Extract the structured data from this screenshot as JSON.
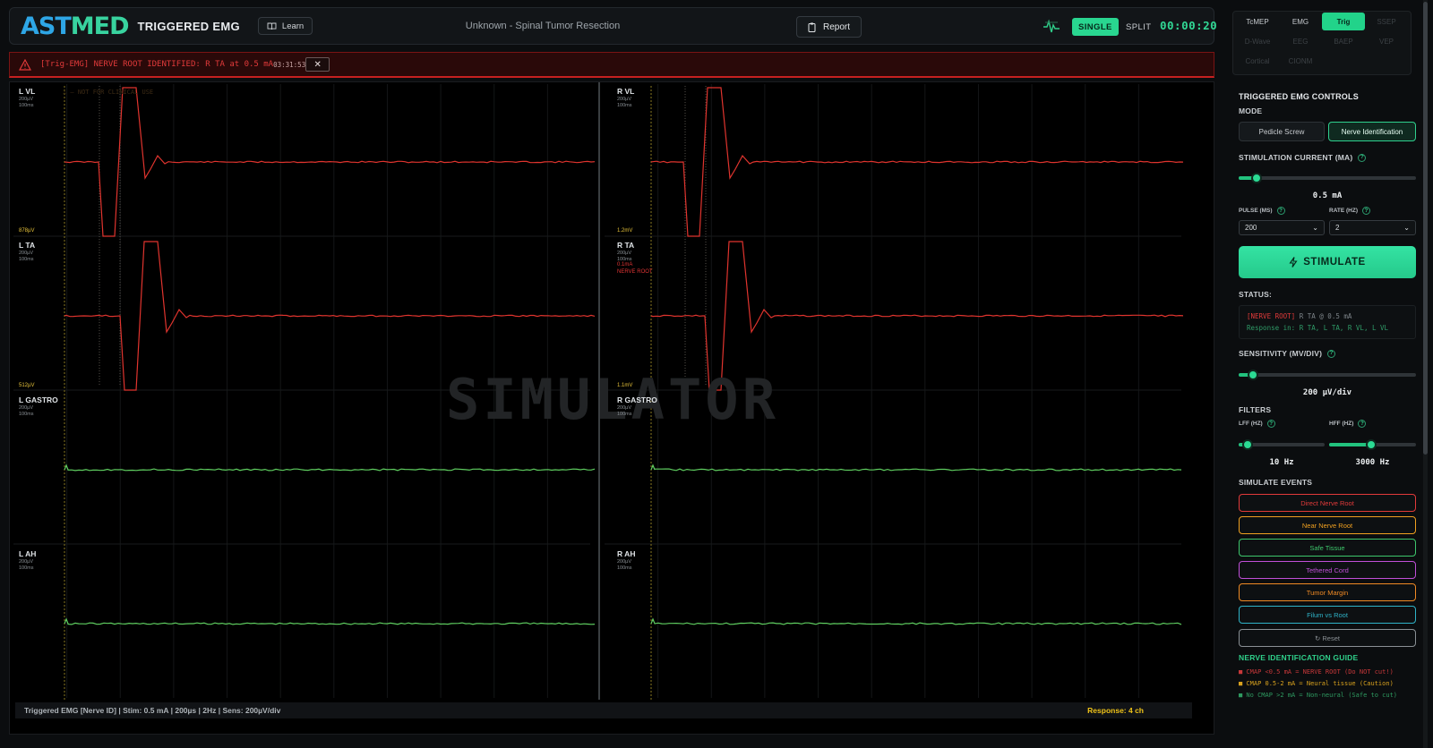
{
  "header": {
    "logo_part1": "AST",
    "logo_part2": "MED",
    "app_title": "TRIGGERED EMG",
    "learn_label": "Learn",
    "procedure": "Unknown - Spinal Tumor Resection",
    "report_label": "Report",
    "single_label": "SINGLE",
    "split_label": "SPLIT",
    "timer": "00:00:20"
  },
  "alert": {
    "text": "[Trig-EMG] NERVE ROOT IDENTIFIED: R TA at 0.5 mA",
    "time": "03:31:53",
    "close": "✕"
  },
  "scope": {
    "watermark": "SIMULATOR",
    "ncu": "⚠ — NOT FOR CLINICAL USE",
    "channels": [
      {
        "name": "L VL",
        "scale": "200µV",
        "time": "100ms",
        "amp": "878µV",
        "color": "#e0342e"
      },
      {
        "name": "L TA",
        "scale": "200µV",
        "time": "100ms",
        "amp": "512µV",
        "color": "#e0342e"
      },
      {
        "name": "L GASTRO",
        "scale": "200µV",
        "time": "100ms",
        "amp": "",
        "color": "#5fce60"
      },
      {
        "name": "L AH",
        "scale": "200µV",
        "time": "100ms",
        "amp": "",
        "color": "#5fce60"
      },
      {
        "name": "R VL",
        "scale": "200µV",
        "time": "100ms",
        "amp": "1.2mV",
        "color": "#e0342e"
      },
      {
        "name": "R TA",
        "scale": "200µV",
        "time": "100ms",
        "amp": "1.1mV",
        "threshold": "0.1mA",
        "flag": "NERVE ROOT",
        "color": "#e0342e"
      },
      {
        "name": "R GASTRO",
        "scale": "200µV",
        "time": "100ms",
        "amp": "",
        "color": "#5fce60"
      },
      {
        "name": "R AH",
        "scale": "200µV",
        "time": "100ms",
        "amp": "",
        "color": "#5fce60"
      }
    ],
    "status_left": "Triggered EMG [Nerve ID] | Stim: 0.5 mA | 200µs | 2Hz | Sens: 200µV/div",
    "status_right": "Response: 4 ch"
  },
  "tabs": [
    {
      "label": "TcMEP",
      "state": "normal"
    },
    {
      "label": "EMG",
      "state": "normal"
    },
    {
      "label": "Trig",
      "state": "active"
    },
    {
      "label": "SSEP",
      "state": "dim"
    },
    {
      "label": "D-Wave",
      "state": "dim"
    },
    {
      "label": "EEG",
      "state": "dim"
    },
    {
      "label": "BAEP",
      "state": "dim"
    },
    {
      "label": "VEP",
      "state": "dim"
    },
    {
      "label": "Cortical",
      "state": "dim"
    },
    {
      "label": "CIONM",
      "state": "dim"
    }
  ],
  "controls": {
    "title": "TRIGGERED EMG CONTROLS",
    "mode_label": "MODE",
    "mode_options": [
      "Pedicle Screw",
      "Nerve Identification"
    ],
    "mode_selected": "Nerve Identification",
    "current_label": "STIMULATION CURRENT (MA)",
    "current_value": "0.5 mA",
    "current_fraction": 0.1,
    "pulse_label": "PULSE (MS)",
    "pulse_value": "200",
    "rate_label": "RATE (HZ)",
    "rate_value": "2",
    "stimulate_label": "STIMULATE",
    "status_label": "STATUS:",
    "status_line1_tag": "[NERVE ROOT]",
    "status_line1_rest": " R TA @ 0.5 mA",
    "status_line2": "Response in: R TA, L TA, R VL, L VL",
    "sensitivity_label": "SENSITIVITY (MV/DIV)",
    "sensitivity_value": "200 µV/div",
    "sensitivity_fraction": 0.08,
    "filters_label": "FILTERS",
    "lff_label": "LFF (HZ)",
    "lff_value": "10 Hz",
    "lff_fraction": 0.1,
    "hff_label": "HFF (HZ)",
    "hff_value": "3000 Hz",
    "hff_fraction": 0.48,
    "events_label": "SIMULATE EVENTS",
    "events": [
      {
        "label": "Direct Nerve Root",
        "color": "#e23a3a"
      },
      {
        "label": "Near Nerve Root",
        "color": "#f0a020"
      },
      {
        "label": "Safe Tissue",
        "color": "#3ec76c"
      },
      {
        "label": "Tethered Cord",
        "color": "#c04fd8"
      },
      {
        "label": "Tumor Margin",
        "color": "#f08a24"
      },
      {
        "label": "Filum vs Root",
        "color": "#2fb3c8"
      },
      {
        "label": "↻ Reset",
        "color": "#8a9095"
      }
    ],
    "guide_title": "NERVE IDENTIFICATION GUIDE",
    "guide": [
      {
        "bullet": "■",
        "text": " CMAP <0.5 mA = NERVE ROOT (Do NOT cut!)",
        "color": "#c8383a"
      },
      {
        "bullet": "■",
        "text": " CMAP 0.5-2 mA = Neural tissue (Caution)",
        "color": "#d9a21e"
      },
      {
        "bullet": "■",
        "text": " No CMAP >2 mA = Non-neural (Safe to cut)",
        "color": "#2e9a60"
      }
    ]
  }
}
